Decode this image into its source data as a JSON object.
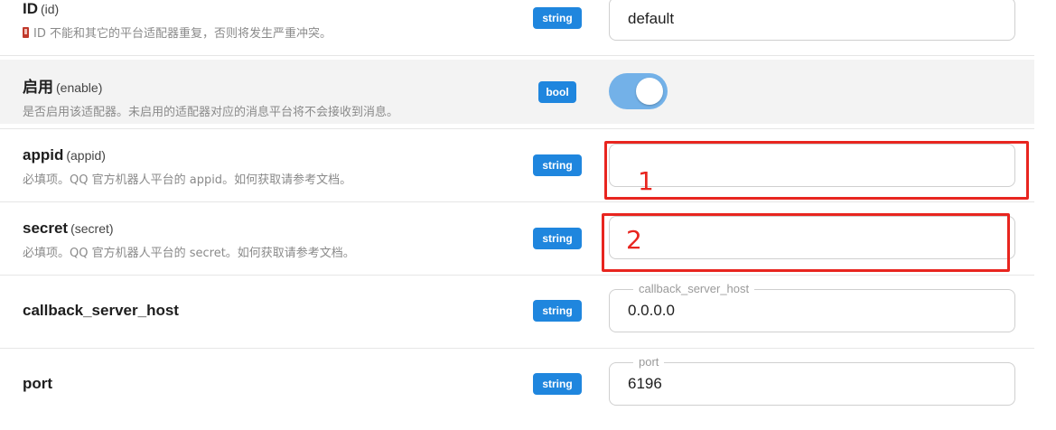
{
  "colors": {
    "badge_bg": "#1f86de",
    "toggle_on": "#73b1e8",
    "annotation": "#e8251f"
  },
  "rows": {
    "id": {
      "name": "ID",
      "key": "(id)",
      "desc": "ID 不能和其它的平台适配器重复，否则将发生严重冲突。",
      "desc_icon": "warning-icon",
      "type": "string",
      "value": "default"
    },
    "enable": {
      "name": "启用",
      "key": "(enable)",
      "desc": "是否启用该适配器。未启用的适配器对应的消息平台将不会接收到消息。",
      "type": "bool",
      "checked": true
    },
    "appid": {
      "name": "appid",
      "key": "(appid)",
      "desc": "必填项。QQ 官方机器人平台的 appid。如何获取请参考文档。",
      "type": "string",
      "value": ""
    },
    "secret": {
      "name": "secret",
      "key": "(secret)",
      "desc": "必填项。QQ 官方机器人平台的 secret。如何获取请参考文档。",
      "type": "string",
      "value": ""
    },
    "callback_server_host": {
      "name": "callback_server_host",
      "type": "string",
      "legend": "callback_server_host",
      "value": "0.0.0.0"
    },
    "port": {
      "name": "port",
      "type": "string",
      "legend": "port",
      "value": "6196"
    }
  },
  "annotations": {
    "first": "1",
    "second": "2"
  }
}
